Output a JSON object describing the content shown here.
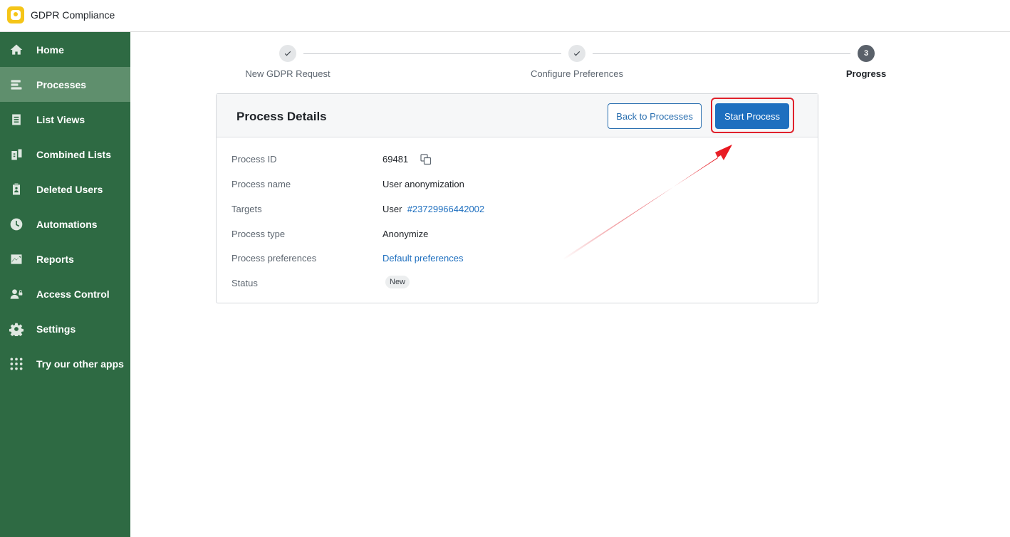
{
  "header": {
    "app_title": "GDPR Compliance"
  },
  "sidebar": {
    "items": [
      {
        "label": "Home",
        "icon": "home-icon",
        "active": false
      },
      {
        "label": "Processes",
        "icon": "processes-icon",
        "active": true
      },
      {
        "label": "List Views",
        "icon": "list-views-icon",
        "active": false
      },
      {
        "label": "Combined Lists",
        "icon": "combined-lists-icon",
        "active": false
      },
      {
        "label": "Deleted Users",
        "icon": "deleted-users-icon",
        "active": false
      },
      {
        "label": "Automations",
        "icon": "clock-icon",
        "active": false
      },
      {
        "label": "Reports",
        "icon": "reports-icon",
        "active": false
      },
      {
        "label": "Access Control",
        "icon": "access-control-icon",
        "active": false
      },
      {
        "label": "Settings",
        "icon": "gear-icon",
        "active": false
      },
      {
        "label": "Try our other apps",
        "icon": "apps-grid-icon",
        "active": false
      }
    ]
  },
  "stepper": {
    "steps": [
      {
        "label": "New GDPR Request",
        "state": "done"
      },
      {
        "label": "Configure Preferences",
        "state": "done"
      },
      {
        "label": "Progress",
        "state": "current",
        "number": "3"
      }
    ]
  },
  "card": {
    "title": "Process Details",
    "back_button": "Back to Processes",
    "start_button": "Start Process",
    "rows": {
      "process_id": {
        "label": "Process ID",
        "value": "69481"
      },
      "process_name": {
        "label": "Process name",
        "value": "User anonymization"
      },
      "targets": {
        "label": "Targets",
        "prefix": "User",
        "link": "#23729966442002"
      },
      "process_type": {
        "label": "Process type",
        "value": "Anonymize"
      },
      "preferences": {
        "label": "Process preferences",
        "link": "Default preferences"
      },
      "status": {
        "label": "Status",
        "badge": "New"
      }
    }
  },
  "colors": {
    "sidebar_bg": "#2e6a43",
    "sidebar_active": "#5f8f6d",
    "primary": "#1e6fbf",
    "annotation_red": "#e0212b",
    "logo_yellow": "#f5c518"
  }
}
